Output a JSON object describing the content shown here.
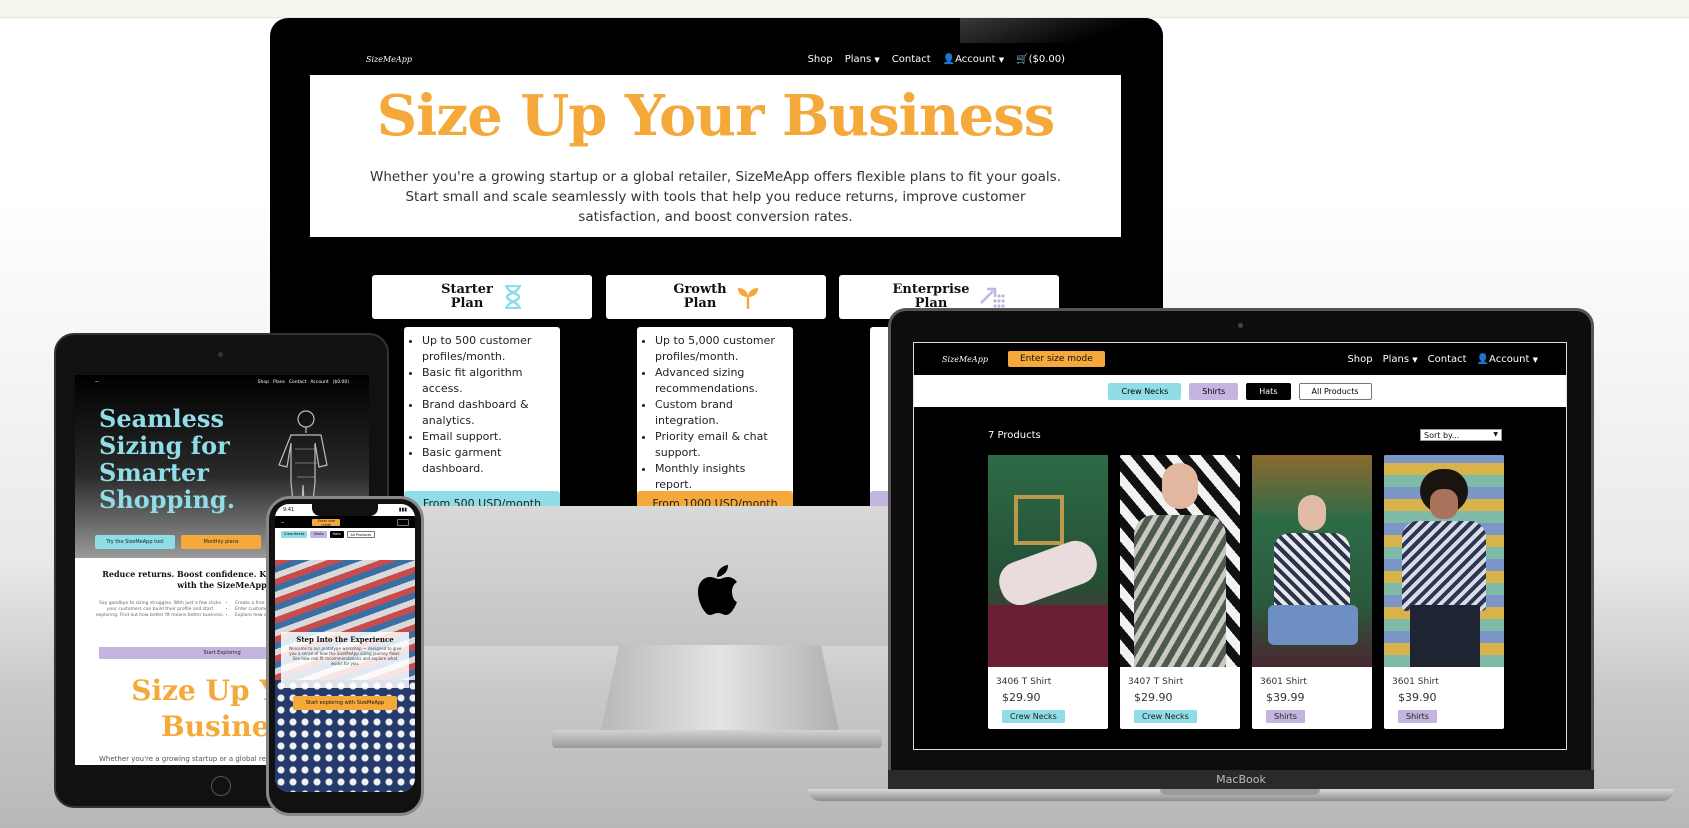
{
  "colors": {
    "accent": "#f4a93a",
    "crew": "#8fdde6",
    "shirts": "#c3b5e0",
    "black": "#000000"
  },
  "desktop": {
    "nav": {
      "logo": "SizeMeApp",
      "links": [
        "Shop",
        "Plans",
        "Contact",
        "Account",
        "($0.00)"
      ]
    },
    "hero": {
      "title": "Size Up Your Business",
      "text": "Whether you're a growing startup or a global retailer, SizeMeApp offers flexible plans to fit your goals. Start small and scale seamlessly with tools that help you reduce returns, improve customer satisfaction, and boost conversion rates."
    },
    "plans": [
      {
        "title_line1": "Starter",
        "title_line2": "Plan",
        "icon": "hourglass-icon",
        "features": [
          "Up to 500 customer profiles/month.",
          "Basic fit algorithm access.",
          "Brand dashboard & analytics.",
          "Email support.",
          "Basic garment dashboard."
        ],
        "cta": "From 500 USD/month"
      },
      {
        "title_line1": "Growth",
        "title_line2": "Plan",
        "icon": "sprout-icon",
        "features": [
          "Up to 5,000 customer profiles/month.",
          "Advanced sizing recommendations.",
          "Custom brand integration.",
          "Priority email & chat support.",
          "Monthly insights report."
        ],
        "cta": "From 1000 USD/month"
      },
      {
        "title_line1": "Enterprise",
        "title_line2": "Plan",
        "icon": "scale-up-icon"
      }
    ]
  },
  "laptop": {
    "nav": {
      "logo": "SizeMeApp",
      "size_mode": "Enter size mode",
      "links": [
        "Shop",
        "Plans",
        "Contact",
        "Account"
      ]
    },
    "filters": [
      "Crew Necks",
      "Shirts",
      "Hats",
      "All Products"
    ],
    "count": "7 Products",
    "sort": "Sort by...",
    "products": [
      {
        "name": "3406 T Shirt",
        "price": "$29.90",
        "tag": "Crew Necks"
      },
      {
        "name": "3407 T Shirt",
        "price": "$29.90",
        "tag": "Crew Necks"
      },
      {
        "name": "3601 Shirt",
        "price": "$39.99",
        "tag": "Shirts"
      },
      {
        "name": "3601 Shirt",
        "price": "$39.90",
        "tag": "Shirts"
      }
    ],
    "brand": "MacBook"
  },
  "tablet": {
    "nav_links": [
      "Shop",
      "Plans",
      "Contact",
      "Account",
      "($0.00)"
    ],
    "hero_title": "Seamless Sizing for Smarter Shopping.",
    "btn_try": "Try the SizeMeApp tool",
    "btn_plans": "Monthly plans",
    "subtitle": "Reduce returns. Boost confidence. Keep coming back with the SizeMeApp",
    "body": "Say goodbye to sizing struggles. With just a few clicks your customers can build their profile and start exploring. Find out how better fit means better business.",
    "bullets": [
      "Create a free account",
      "Enter customer measurements",
      "Explore how our experience"
    ],
    "start": "Start Exploring",
    "big_title": "Size Up Your Business",
    "footer": "Whether you're a growing startup or a global retailer"
  },
  "phone": {
    "time": "9:41",
    "size_mode": "Enter size mode",
    "filters": [
      "Crew Necks",
      "Shirts",
      "Hats",
      "All Products"
    ],
    "card_title": "Step Into the Experience",
    "card_text": "Welcome to our prototype workshop — designed to give you a sense of how the SizeMeApp sizing journey flows. See how real fit recommendations and explore what works for you.",
    "cta": "Start exploring with SizeMeApp"
  }
}
